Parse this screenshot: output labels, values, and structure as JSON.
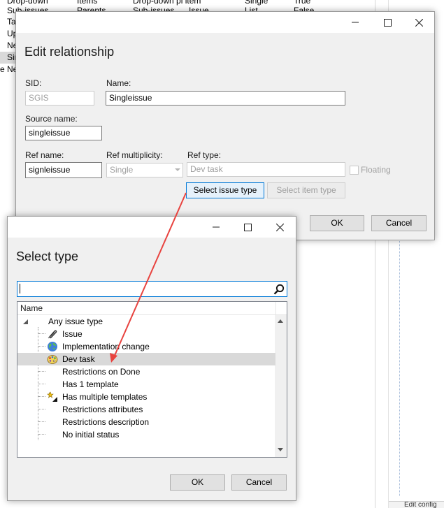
{
  "background": {
    "rows": [
      {
        "col1": "Drop-down",
        "col2": "Items",
        "col3": "Drop-down pi item",
        "col4": "",
        "col5": "Single",
        "col6": "True"
      },
      {
        "col1": "Sub-issues",
        "col2": "Parents",
        "col3": "Sub-issues",
        "col4": "Issue",
        "col5": "List",
        "col6": "False"
      }
    ],
    "left_rows": [
      "Ta",
      "Up",
      "Ne",
      "Sir",
      "Ne"
    ],
    "bottom_strip_text": "Edit config",
    "tree_marker": "e"
  },
  "edit_relationship": {
    "title": "Edit relationship",
    "sid_label": "SID:",
    "sid_value": "SGIS",
    "name_label": "Name:",
    "name_value": "Singleissue",
    "source_name_label": "Source name:",
    "source_name_value": "singleissue",
    "ref_name_label": "Ref name:",
    "ref_name_value": "signleissue",
    "ref_multiplicity_label": "Ref multiplicity:",
    "ref_multiplicity_value": "Single",
    "ref_type_label": "Ref type:",
    "ref_type_value": "Dev task",
    "floating_label": "Floating",
    "select_issue_type_label": "Select issue type",
    "select_item_type_label": "Select item type",
    "ok_label": "OK",
    "cancel_label": "Cancel"
  },
  "select_type": {
    "title": "Select type",
    "search_value": "",
    "column_header": "Name",
    "items": [
      {
        "label": "Any issue type",
        "icon": "none"
      },
      {
        "label": "Issue",
        "icon": "paperclip-icon"
      },
      {
        "label": "Implementation change",
        "icon": "globe-icon"
      },
      {
        "label": "Dev task",
        "icon": "palette-icon",
        "selected": true
      },
      {
        "label": "Restrictions on Done",
        "icon": "none"
      },
      {
        "label": "Has 1 template",
        "icon": "none"
      },
      {
        "label": "Has multiple templates",
        "icon": "wand-icon"
      },
      {
        "label": "Restrictions attributes",
        "icon": "none"
      },
      {
        "label": "Restrictions description",
        "icon": "none"
      },
      {
        "label": "No initial status",
        "icon": "none"
      }
    ],
    "ok_label": "OK",
    "cancel_label": "Cancel"
  },
  "colors": {
    "annotation_arrow": "#e8433f",
    "focus_blue": "#0078d7",
    "selection_gray": "#d9d9d9"
  }
}
